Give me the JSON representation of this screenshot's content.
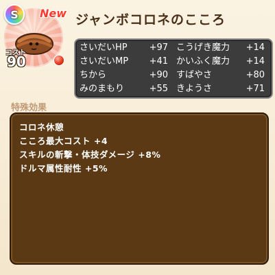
{
  "badge": {
    "rank": "S",
    "new_label": "New"
  },
  "title": "ジャンボコロネのこころ",
  "icon": {
    "monster": "jumbo-corone-icon",
    "cost_label": "コスト",
    "cost_value": "90"
  },
  "stats": [
    {
      "name": "さいだいHP",
      "value": "+97"
    },
    {
      "name": "こうげき魔力",
      "value": "+14"
    },
    {
      "name": "さいだいMP",
      "value": "+41"
    },
    {
      "name": "かいふく魔力",
      "value": "+14"
    },
    {
      "name": "ちから",
      "value": "+90"
    },
    {
      "name": "すばやさ",
      "value": "+80"
    },
    {
      "name": "みのまもり",
      "value": "+55"
    },
    {
      "name": "きようさ",
      "value": "+71"
    }
  ],
  "special_effects": {
    "title": "特殊効果",
    "items": [
      "コロネ休憩",
      "こころ最大コスト +4",
      "スキルの斬撃・体技ダメージ +8%",
      "ドルマ属性耐性 +5%"
    ]
  }
}
